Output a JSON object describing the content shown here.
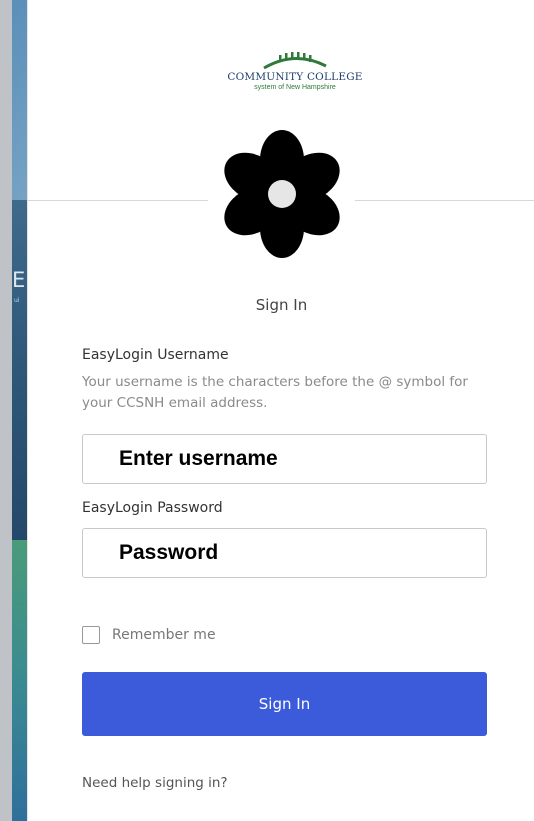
{
  "logo": {
    "line1": "COMMUNITY COLLEGE",
    "line2": "system of New Hampshire"
  },
  "form": {
    "title": "Sign In",
    "username_label": "EasyLogin Username",
    "username_hint": "Your username is the characters before the @ symbol for your CCSNH email address.",
    "username_placeholder": "Enter username",
    "password_label": "EasyLogin Password",
    "password_placeholder": "Password",
    "remember_label": "Remember me",
    "remember_checked": false,
    "submit_label": "Sign In",
    "help_link": "Need help signing in?"
  },
  "colors": {
    "primary_button": "#3b5bdb",
    "logo_arc": "#2d7a3a",
    "logo_text": "#1f3e6e"
  },
  "icons": {
    "avatar": "flower-icon"
  }
}
